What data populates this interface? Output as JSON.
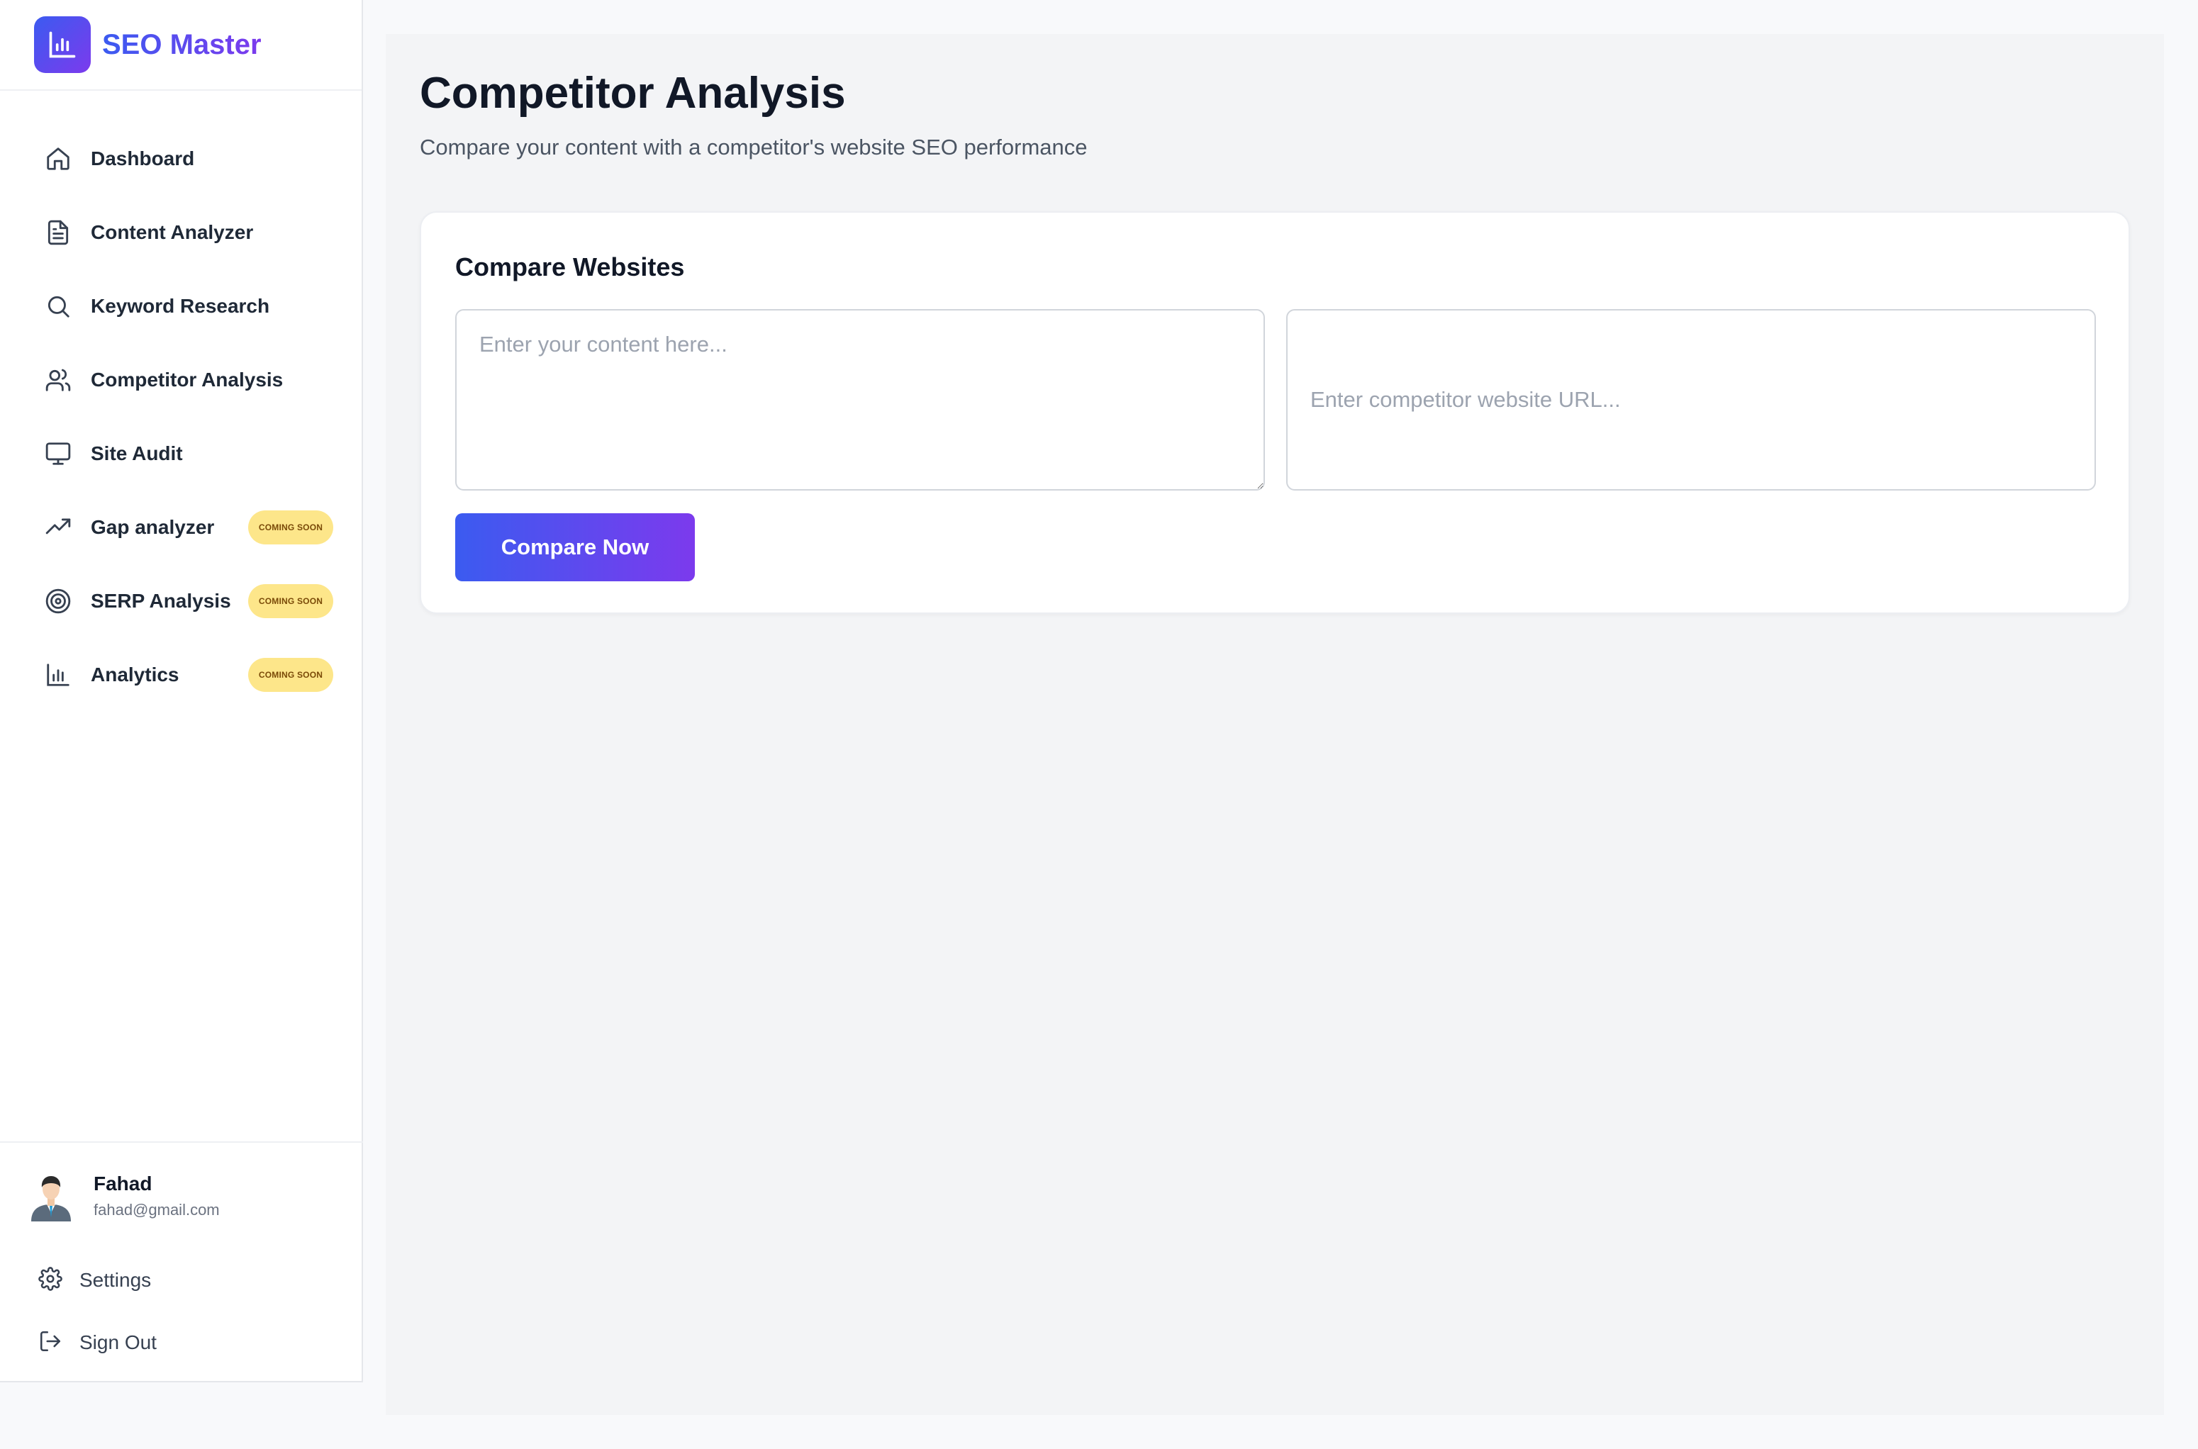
{
  "brand": {
    "name": "SEO Master",
    "logo_icon": "bar-chart-icon",
    "gradient": [
      "#3b5bf0",
      "#7c3aed"
    ]
  },
  "sidebar": {
    "items": [
      {
        "label": "Dashboard",
        "icon": "home-icon"
      },
      {
        "label": "Content Analyzer",
        "icon": "file-text-icon"
      },
      {
        "label": "Keyword Research",
        "icon": "search-icon"
      },
      {
        "label": "Competitor Analysis",
        "icon": "users-icon"
      },
      {
        "label": "Site Audit",
        "icon": "monitor-icon"
      },
      {
        "label": "Gap analyzer",
        "icon": "trending-up-icon",
        "badge": "COMING SOON"
      },
      {
        "label": "SERP Analysis",
        "icon": "target-icon",
        "badge": "COMING SOON"
      },
      {
        "label": "Analytics",
        "icon": "bar-chart-icon",
        "badge": "COMING SOON"
      }
    ]
  },
  "user": {
    "name": "Fahad",
    "email": "fahad@gmail.com"
  },
  "footer": {
    "settings_label": "Settings",
    "signout_label": "Sign Out"
  },
  "main": {
    "title": "Competitor Analysis",
    "subtitle": "Compare your content with a competitor's website SEO performance",
    "card": {
      "title": "Compare Websites",
      "content_placeholder": "Enter your content here...",
      "url_placeholder": "Enter competitor website URL...",
      "button_label": "Compare Now"
    }
  },
  "colors": {
    "badge_bg": "#fde68a",
    "badge_text": "#7a4a08",
    "accent_start": "#3b5bf0",
    "accent_end": "#7c3aed"
  }
}
